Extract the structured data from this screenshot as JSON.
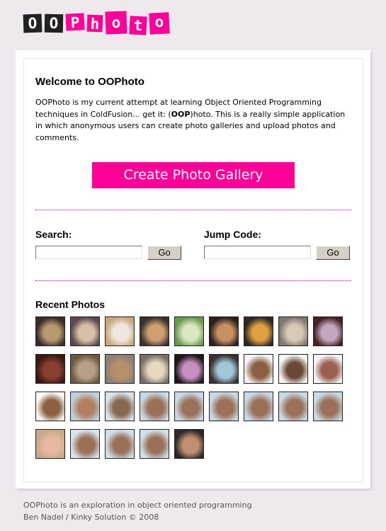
{
  "logo": {
    "letters": [
      "O",
      "O",
      "P",
      "h",
      "o",
      "t",
      "o"
    ],
    "colors": {
      "dark": "#222222",
      "accent": "#ff0099"
    },
    "alt": "OOPhoto"
  },
  "welcome": {
    "title": "Welcome to OOPhoto",
    "intro_part1": "OOPhoto is my current attempt at learning Object Oriented Programming techniques in ColdFusion... get it: (",
    "intro_bold": "OOP",
    "intro_part2": ")hoto. This is a really simple application in which anonymous users can create photo galleries and upload photos and comments."
  },
  "create_button": {
    "label": "Create Photo Gallery",
    "color": "#ff0099"
  },
  "search": {
    "label": "Search:",
    "value": "",
    "button": "Go"
  },
  "jump": {
    "label": "Jump Code:",
    "value": "",
    "button": "Go"
  },
  "recent": {
    "title": "Recent Photos",
    "photos": [
      {
        "c1": "#3a2a28",
        "c2": "#b89a70"
      },
      {
        "c1": "#5a4a50",
        "c2": "#d8c0a8"
      },
      {
        "c1": "#c8a878",
        "c2": "#f0e8e0"
      },
      {
        "c1": "#3a3030",
        "c2": "#d0a070"
      },
      {
        "c1": "#6a9a50",
        "c2": "#d8e8c0"
      },
      {
        "c1": "#2a2020",
        "c2": "#c89060"
      },
      {
        "c1": "#302828",
        "c2": "#e0a040"
      },
      {
        "c1": "#807870",
        "c2": "#d8c8b8"
      },
      {
        "c1": "#4a2020",
        "c2": "#c0a8c0"
      },
      {
        "c1": "#3a1a10",
        "c2": "#8a4030"
      },
      {
        "c1": "#6a5a40",
        "c2": "#b8a088"
      },
      {
        "c1": "#8a8078",
        "c2": "#b89068"
      },
      {
        "c1": "#787068",
        "c2": "#e8d8c0"
      },
      {
        "c1": "#201818",
        "c2": "#c890c0"
      },
      {
        "c1": "#3a3030",
        "c2": "#a0c8d8"
      },
      {
        "c1": "#f4f4f4",
        "c2": "#8a6040"
      },
      {
        "c1": "#f4f4f4",
        "c2": "#6a4838"
      },
      {
        "c1": "#f4f4f4",
        "c2": "#9a6050"
      },
      {
        "c1": "#f8f8f8",
        "c2": "#8a6040"
      },
      {
        "c1": "#c0d0d8",
        "c2": "#b08060"
      },
      {
        "c1": "#d8e4ec",
        "c2": "#8a6850"
      },
      {
        "c1": "#c8d8e4",
        "c2": "#9a7058"
      },
      {
        "c1": "#c8d8e4",
        "c2": "#9a7058"
      },
      {
        "c1": "#c8d8e4",
        "c2": "#9a7058"
      },
      {
        "c1": "#c8d8e4",
        "c2": "#9a7058"
      },
      {
        "c1": "#c8d8e4",
        "c2": "#9a7058"
      },
      {
        "c1": "#c8d8e4",
        "c2": "#9a7058"
      },
      {
        "c1": "#c8a888",
        "c2": "#e8b8a0"
      },
      {
        "c1": "#d8e4ec",
        "c2": "#9a7058"
      },
      {
        "c1": "#d0e0e8",
        "c2": "#9a7058"
      },
      {
        "c1": "#d0e0e8",
        "c2": "#9a7058"
      },
      {
        "c1": "#302828",
        "c2": "#c09070"
      }
    ]
  },
  "footer": {
    "line1": "OOPhoto is an exploration in object oriented programming",
    "line2": "Ben Nadel / Kinky Solution © 2008"
  }
}
